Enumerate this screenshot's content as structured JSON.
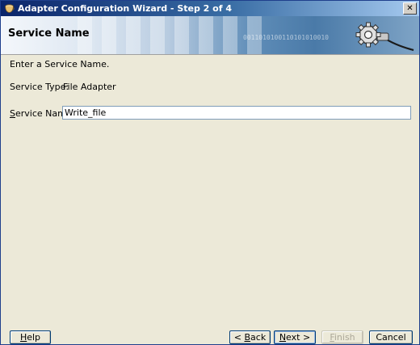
{
  "window": {
    "title": "Adapter Configuration Wizard - Step 2 of 4",
    "close_glyph": "✕"
  },
  "header": {
    "title": "Service Name",
    "binary_decoration": "0011010100110101010010",
    "icon": "gear-plug-icon"
  },
  "content": {
    "instruction": "Enter a Service Name.",
    "service_type_label": "Service Type:",
    "service_type_value": "File Adapter",
    "service_name_label_first": "S",
    "service_name_label_rest": "ervice Name:",
    "service_name_value": "Write_file"
  },
  "buttons": {
    "help_first": "H",
    "help_rest": "elp",
    "back_prefix": "< ",
    "back_first": "B",
    "back_rest": "ack",
    "next_first": "N",
    "next_rest": "ext >",
    "finish_first": "F",
    "finish_rest": "inish",
    "cancel": "Cancel"
  },
  "colors": {
    "titlebar_start": "#0a246a",
    "titlebar_end": "#a6caf0",
    "dialog_bg": "#ece9d8",
    "input_border": "#7f9db9"
  }
}
